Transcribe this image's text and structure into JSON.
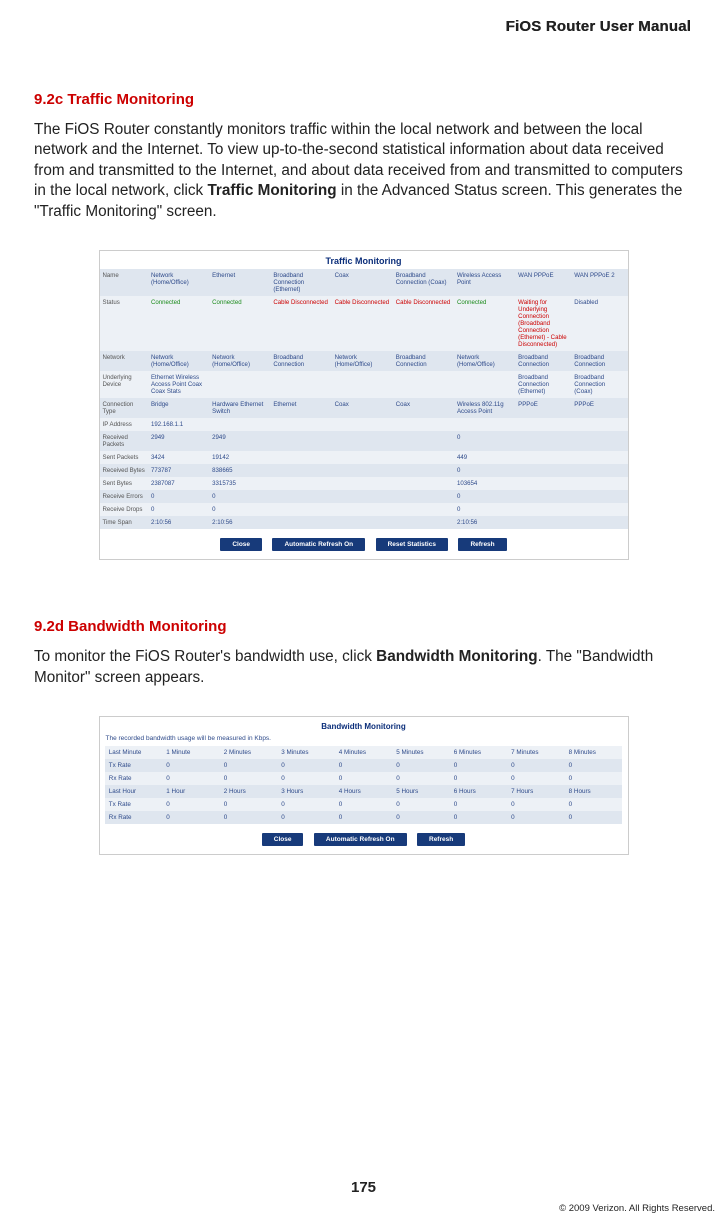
{
  "header": {
    "manual_title": "FiOS Router User Manual"
  },
  "section1": {
    "heading": "9.2c  Traffic Monitoring",
    "p1a": "The FiOS Router constantly monitors traffic within the local network and between the local network and the Internet. To view up-to-the-second statistical information about data received from and transmitted to the Internet, and about data received from and transmitted to computers in the local network, click ",
    "p1b_bold": "Traffic Monitoring",
    "p1c": " in the Advanced Status screen. This generates the \"Traffic Monitoring\" screen."
  },
  "traffic": {
    "title": "Traffic Monitoring",
    "rows": {
      "name": {
        "label": "Name",
        "cells": [
          "Network (Home/Office)",
          "Ethernet",
          "Broadband Connection (Ethernet)",
          "Coax",
          "Broadband Connection (Coax)",
          "Wireless Access Point",
          "WAN PPPoE",
          "WAN PPPoE 2"
        ]
      },
      "status": {
        "label": "Status",
        "cells": [
          "Connected",
          "Connected",
          "Cable Disconnected",
          "Cable Disconnected",
          "Cable Disconnected",
          "Connected",
          "Waiting for Underlying Connection (Broadband Connection (Ethernet) - Cable Disconnected)",
          "Disabled"
        ]
      },
      "network": {
        "label": "Network",
        "cells": [
          "Network (Home/Office)",
          "Network (Home/Office)",
          "Broadband Connection",
          "Network (Home/Office)",
          "Broadband Connection",
          "Network (Home/Office)",
          "Broadband Connection",
          "Broadband Connection"
        ]
      },
      "underlying": {
        "label": "Underlying Device",
        "cells": [
          "Ethernet Wireless Access Point Coax Coax Stats",
          "",
          "",
          "",
          "",
          "",
          "Broadband Connection (Ethernet)",
          "Broadband Connection (Coax)"
        ]
      },
      "conntype": {
        "label": "Connection Type",
        "cells": [
          "Bridge",
          "Hardware Ethernet Switch",
          "Ethernet",
          "Coax",
          "Coax",
          "Wireless 802.11g Access Point",
          "PPPoE",
          "PPPoE"
        ]
      },
      "ip": {
        "label": "IP Address",
        "cells": [
          "192.168.1.1",
          "",
          "",
          "",
          "",
          "",
          "",
          ""
        ]
      },
      "rxpackets": {
        "label": "Received Packets",
        "cells": [
          "2949",
          "2949",
          "",
          "",
          "",
          "0",
          "",
          ""
        ]
      },
      "txpackets": {
        "label": "Sent Packets",
        "cells": [
          "3424",
          "19142",
          "",
          "",
          "",
          "449",
          "",
          ""
        ]
      },
      "rxbytes": {
        "label": "Received Bytes",
        "cells": [
          "773787",
          "838665",
          "",
          "",
          "",
          "0",
          "",
          ""
        ]
      },
      "txbytes": {
        "label": "Sent Bytes",
        "cells": [
          "2387087",
          "3315735",
          "",
          "",
          "",
          "103654",
          "",
          ""
        ]
      },
      "rxerrors": {
        "label": "Receive Errors",
        "cells": [
          "0",
          "0",
          "",
          "",
          "",
          "0",
          "",
          ""
        ]
      },
      "rxdrops": {
        "label": "Receive Drops",
        "cells": [
          "0",
          "0",
          "",
          "",
          "",
          "0",
          "",
          ""
        ]
      },
      "timespan": {
        "label": "Time Span",
        "cells": [
          "2:10:56",
          "2:10:56",
          "",
          "",
          "",
          "2:10:56",
          "",
          ""
        ]
      }
    },
    "buttons": {
      "close": "Close",
      "auto": "Automatic Refresh On",
      "reset": "Reset Statistics",
      "refresh": "Refresh"
    }
  },
  "section2": {
    "heading": "9.2d  Bandwidth Monitoring",
    "p1a": "To monitor the FiOS Router's bandwidth use, click ",
    "p1b_bold": "Bandwidth Monitoring",
    "p1c": ". The \"Bandwidth Monitor\" screen appears."
  },
  "bandwidth": {
    "title": "Bandwidth Monitoring",
    "note": "The recorded bandwidth usage will be measured in Kbps.",
    "head_min": [
      "Last Minute",
      "1 Minute",
      "2 Minutes",
      "3 Minutes",
      "4 Minutes",
      "5 Minutes",
      "6 Minutes",
      "7 Minutes",
      "8 Minutes"
    ],
    "tx_min": [
      "Tx Rate",
      "0",
      "0",
      "0",
      "0",
      "0",
      "0",
      "0",
      "0"
    ],
    "rx_min": [
      "Rx Rate",
      "0",
      "0",
      "0",
      "0",
      "0",
      "0",
      "0",
      "0"
    ],
    "head_hr": [
      "Last Hour",
      "1 Hour",
      "2 Hours",
      "3 Hours",
      "4 Hours",
      "5 Hours",
      "6 Hours",
      "7 Hours",
      "8 Hours"
    ],
    "tx_hr": [
      "Tx Rate",
      "0",
      "0",
      "0",
      "0",
      "0",
      "0",
      "0",
      "0"
    ],
    "rx_hr": [
      "Rx Rate",
      "0",
      "0",
      "0",
      "0",
      "0",
      "0",
      "0",
      "0"
    ],
    "buttons": {
      "close": "Close",
      "auto": "Automatic Refresh On",
      "refresh": "Refresh"
    }
  },
  "footer": {
    "page": "175",
    "copyright": "© 2009 Verizon. All Rights Reserved."
  }
}
